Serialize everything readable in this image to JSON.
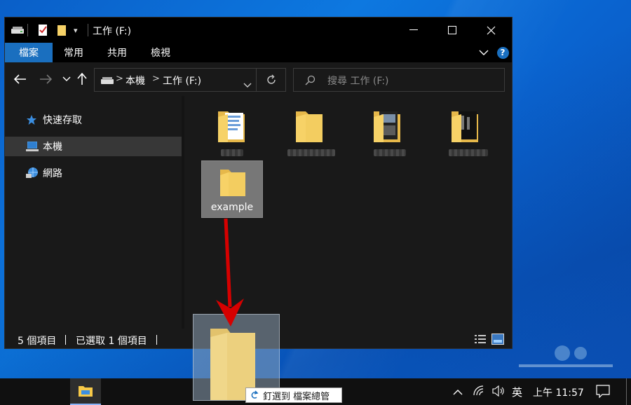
{
  "window": {
    "title": "工作 (F:)",
    "ribbon_tabs": [
      "檔案",
      "常用",
      "共用",
      "檢視"
    ],
    "help_label": "?"
  },
  "nav": {
    "address_drive": "本機",
    "address_sep": ">",
    "address_folder": "工作 (F:)",
    "search_placeholder": "搜尋 工作 (F:)"
  },
  "sidebar": {
    "items": [
      {
        "label": "快速存取",
        "icon": "star-icon"
      },
      {
        "label": "本機",
        "icon": "computer-icon",
        "selected": true
      },
      {
        "label": "網路",
        "icon": "network-icon"
      }
    ]
  },
  "content": {
    "selected_folder_label": "example"
  },
  "status": {
    "item_count": "5 個項目",
    "selection": "已選取 1 個項目"
  },
  "drag": {
    "tooltip_text": "釘選到 檔案總管"
  },
  "taskbar": {
    "ime": "英",
    "clock": "上午 11:57"
  },
  "colors": {
    "accent": "#1a6fbf",
    "folder": "#f7d267",
    "arrow": "#d60000"
  }
}
